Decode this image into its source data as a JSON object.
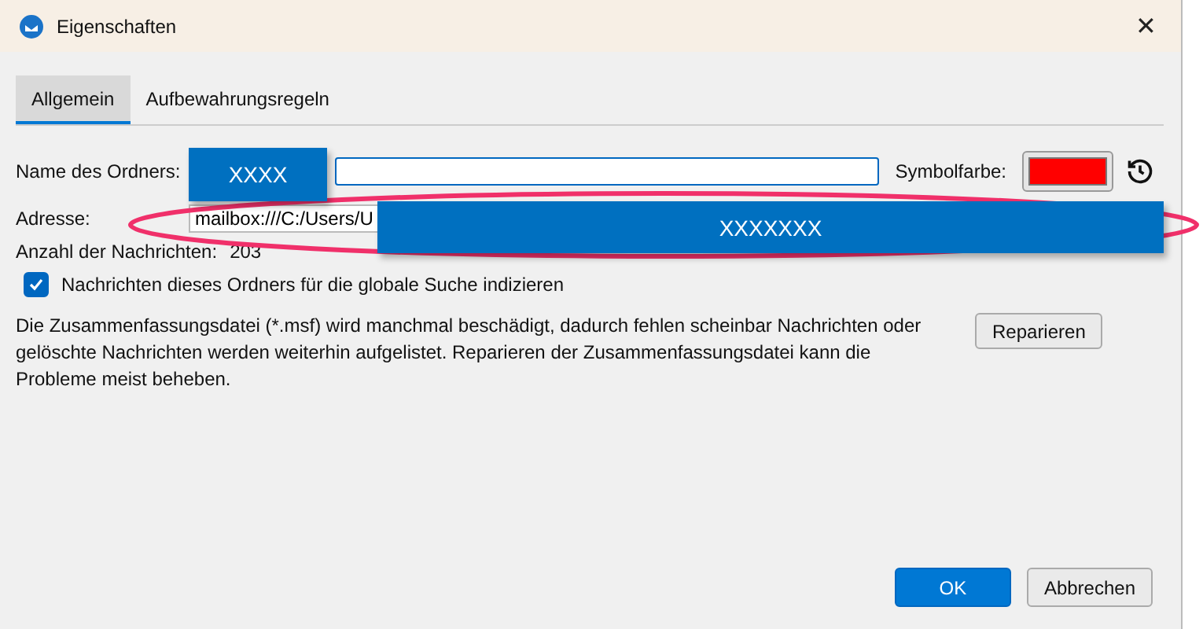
{
  "window": {
    "title": "Eigenschaften",
    "close": "✕"
  },
  "tabs": [
    {
      "label": "Allgemein",
      "selected": true
    },
    {
      "label": "Aufbewahrungsregeln",
      "selected": false
    }
  ],
  "name_field": {
    "label": "Name des Ordners:"
  },
  "icon_color": {
    "label": "Symbolfarbe:",
    "color": "#ff0000"
  },
  "address": {
    "label": "Adresse:",
    "value": "mailbox:///C:/Users/U"
  },
  "message_count": {
    "label": "Anzahl der Nachrichten:",
    "value": "203"
  },
  "index_checkbox": {
    "label": "Nachrichten dieses Ordners für die globale Suche indizieren",
    "checked": true
  },
  "repair": {
    "text": "Die Zusammenfassungsdatei (*.msf) wird manchmal beschädigt, dadurch fehlen scheinbar Nachrichten oder gelöschte Nachrichten werden weiterhin aufgelistet. Reparieren der Zusammenfassungsdatei kann die Probleme meist beheben.",
    "button": "Reparieren"
  },
  "redactions": [
    {
      "text": "XXXX"
    },
    {
      "text": "XXXXXXX"
    }
  ],
  "buttons": [
    {
      "label": "OK",
      "kind": "primary"
    },
    {
      "label": "Abbrechen",
      "kind": "secondary"
    }
  ]
}
